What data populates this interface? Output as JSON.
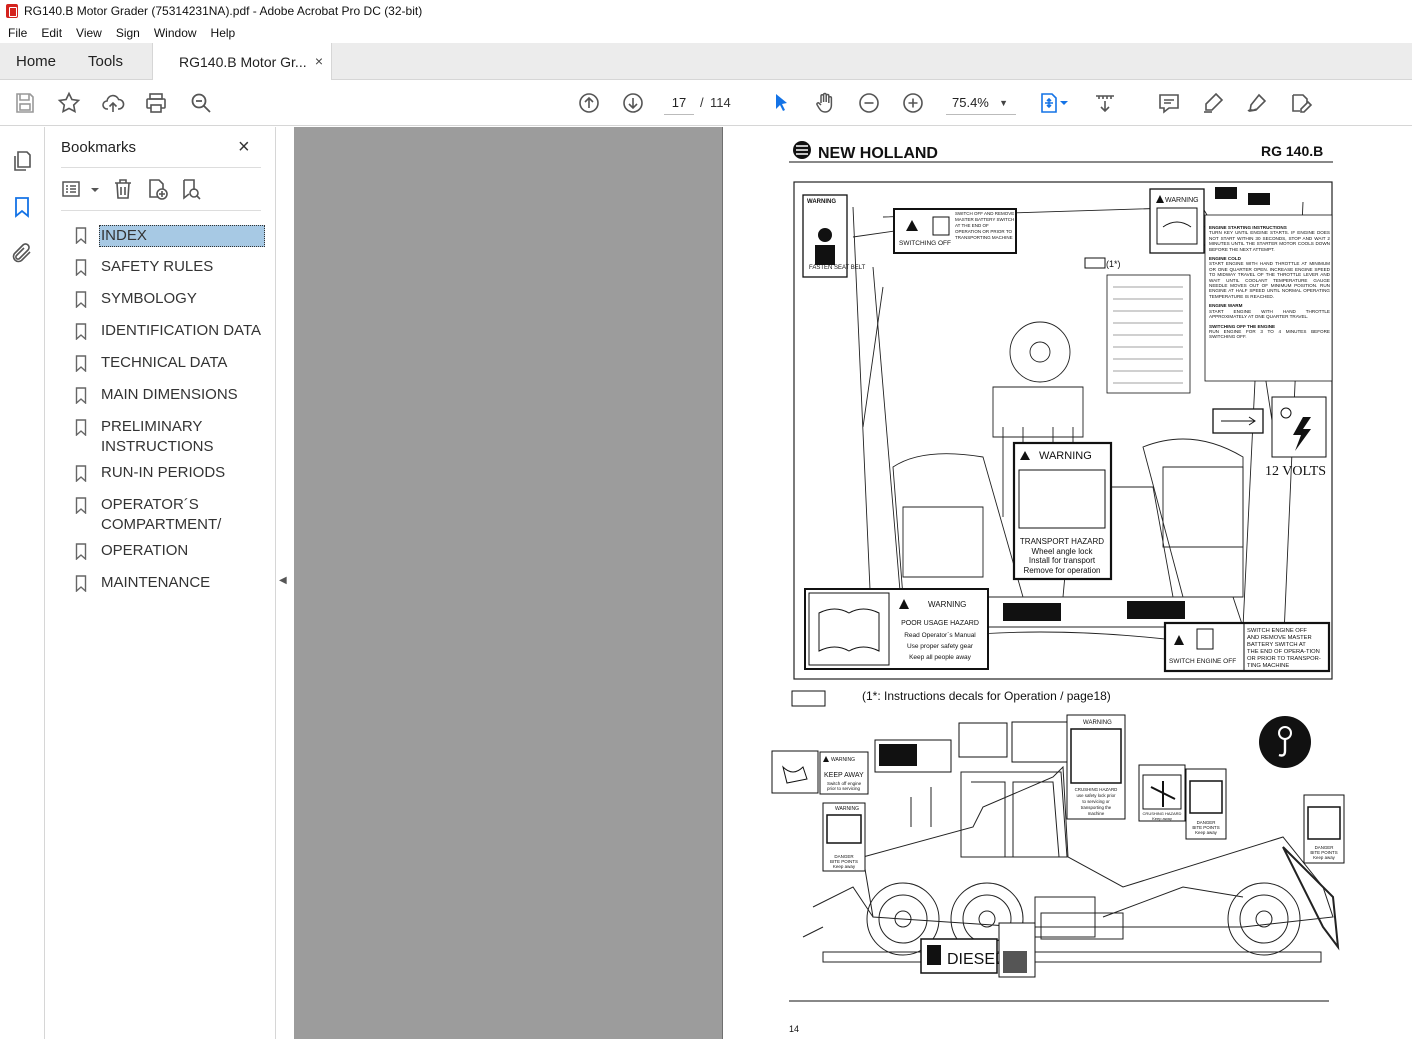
{
  "window": {
    "title": "RG140.B Motor Grader (75314231NA).pdf - Adobe Acrobat Pro DC (32-bit)"
  },
  "menu": [
    "File",
    "Edit",
    "View",
    "Sign",
    "Window",
    "Help"
  ],
  "tabs": {
    "home": "Home",
    "tools": "Tools",
    "document": "RG140.B Motor Gr...",
    "close": "×"
  },
  "toolbar": {
    "current_page": "17",
    "separator": "/",
    "total_pages": "114",
    "zoom": "75.4%"
  },
  "bookmarks_panel": {
    "title": "Bookmarks",
    "close": "×",
    "items": [
      "INDEX",
      "SAFETY RULES",
      "SYMBOLOGY",
      "IDENTIFICATION DATA",
      "TECHNICAL DATA",
      "MAIN DIMENSIONS",
      "PRELIMINARY INSTRUCTIONS",
      "RUN-IN PERIODS",
      "OPERATOR´S COMPARTMENT/",
      "OPERATION",
      "MAINTENANCE"
    ],
    "selected_index": 0
  },
  "document_page": {
    "brand": "NEW HOLLAND",
    "model": "RG 140.B",
    "caption": "(1*: Instructions decals for Operation / page18)",
    "callout": "(1*)",
    "page_number": "14",
    "decals": {
      "seat_belt_warning": "WARNING",
      "seat_belt": "FASTEN SEAT BELT",
      "switching_off": "SWITCHING OFF",
      "switching_off_text": "SWITCH OFF AND REMOVE MASTER BATTERY SWITCH AT THE END OF OPERATION OR PRIOR TO TRANSPORTING MACHINE",
      "manual_warning": "WARNING",
      "engine_start_title": "ENGINE STARTING INSTRUCTIONS",
      "engine_start_text": "TURN KEY UNTIL ENGINE STARTS. IF ENGINE DOES NOT START WITHIN 30 SECONDS, STOP AND WAIT 2 MINUTES UNTIL THE STARTER MOTOR COOLS DOWN BEFORE THE NEXT ATTEMPT.",
      "engine_cold_title": "ENGINE COLD",
      "engine_cold_text": "START ENGINE WITH HAND THROTTLE AT MINIMUM OR ONE QUARTER OPEN. INCREASE ENGINE SPEED TO MIDWAY TRAVEL OF THE THROTTLE LEVER AND WAIT UNTIL COOLANT TEMPERATURE GAUGE NEEDLE MOVES OUT OF MINIMUM POSITION. RUN ENGINE AT HALF SPEED UNTIL NORMAL OPERATING TEMPERATURE IS REACHED.",
      "engine_warm_title": "ENGINE WARM",
      "engine_warm_text": "START ENGINE WITH HAND THROTTLE APPROXIMATELY AT ONE QUARTER TRAVEL.",
      "engine_off_title": "SWITCHING OFF THE ENGINE",
      "engine_off_text": "RUN ENGINE FOR 3 TO 4 MINUTES BEFORE SWITCHING OFF.",
      "volts": "12 VOLTS",
      "transport_warning": "WARNING",
      "transport_lines": [
        "TRANSPORT HAZARD",
        "Wheel angle lock",
        "Install for transport",
        "Remove for operation"
      ],
      "usage_warning": "WARNING",
      "usage_lines": [
        "POOR USAGE HAZARD",
        "Read Operator´s Manual",
        "Use proper safety gear",
        "Keep all people away"
      ],
      "switch_engine_off": "SWITCH ENGINE OFF",
      "switch_engine_off_text": [
        "SWITCH ENGINE OFF",
        "AND REMOVE MASTER",
        "BATTERY SWITCH AT",
        "THE END OF OPERA-TION",
        "OR PRIOR TO TRANSPOR-",
        "TING MACHINE"
      ],
      "keep_away_warning": "WARNING",
      "keep_away": "KEEP AWAY",
      "keep_away_text": [
        "Switch off engine",
        "prior to servicing"
      ],
      "bite_warning": "WARNING",
      "bite_text": [
        "DANGER",
        "BITE POINTS",
        "Keep away"
      ],
      "crushing_warning": "WARNING",
      "crushing_text": [
        "CRUSHING HAZARD",
        "use safety lock prior",
        "to servicing or",
        "transporting the",
        "machine"
      ],
      "crushing_small": "CRUSHING HAZARD",
      "keep_away_small": "Keep away",
      "diesel": "DIESEL"
    }
  },
  "colors": {
    "accent_blue": "#1473e6",
    "selection": "#a7c9e4",
    "viewer_bg": "#9c9c9c"
  }
}
